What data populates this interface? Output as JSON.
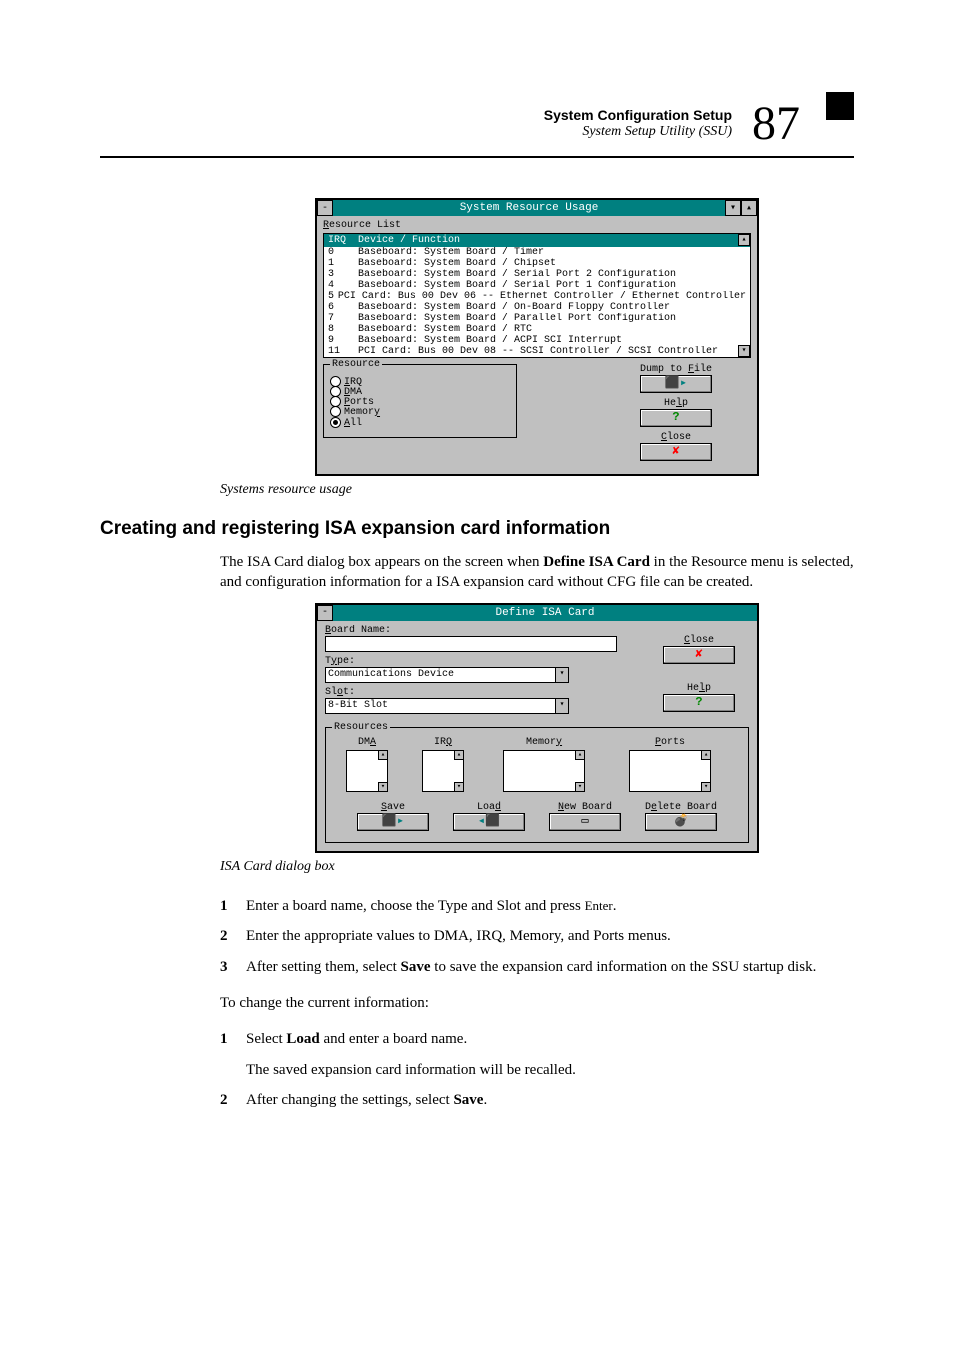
{
  "header": {
    "title": "System Configuration Setup",
    "subtitle": "System Setup Utility (SSU)",
    "page_number": "87"
  },
  "dialog1": {
    "title": "System Resource Usage",
    "list_label": "Resource List",
    "col_irq": "IRQ",
    "col_dev": "Device / Function",
    "rows": [
      {
        "irq": "0",
        "dev": "Baseboard: System Board / Timer"
      },
      {
        "irq": "1",
        "dev": "Baseboard: System Board / Chipset"
      },
      {
        "irq": "3",
        "dev": "Baseboard: System Board / Serial Port 2 Configuration"
      },
      {
        "irq": "4",
        "dev": "Baseboard: System Board / Serial Port 1 Configuration"
      },
      {
        "irq": "5",
        "dev": "PCI Card: Bus 00 Dev 06 -- Ethernet Controller / Ethernet Controller"
      },
      {
        "irq": "6",
        "dev": "Baseboard: System Board / On-Board Floppy Controller"
      },
      {
        "irq": "7",
        "dev": "Baseboard: System Board / Parallel Port Configuration"
      },
      {
        "irq": "8",
        "dev": "Baseboard: System Board / RTC"
      },
      {
        "irq": "9",
        "dev": "Baseboard: System Board / ACPI SCI Interrupt"
      },
      {
        "irq": "11",
        "dev": "PCI Card: Bus 00 Dev 08 -- SCSI Controller / SCSI Controller"
      }
    ],
    "group_label": "Resource",
    "radio_irq": "IRQ",
    "radio_dma": "DMA",
    "radio_ports": "Ports",
    "radio_memory": "Memory",
    "radio_all": "All",
    "btn_dump": "Dump to File",
    "btn_help": "Help",
    "btn_close": "Close"
  },
  "caption1": "Systems resource usage",
  "section_heading": "Creating and registering ISA expansion card information",
  "para1_a": "The ISA Card dialog box appears on the screen when ",
  "para1_bold": "Define ISA Card",
  "para1_b": " in the Resource menu is selected, and configuration information for a ISA expansion card without CFG file can be created.",
  "dialog2": {
    "title": "Define ISA Card",
    "board_name_label": "Board Name:",
    "type_label": "Type:",
    "type_value": "Communications Device",
    "slot_label": "Slot:",
    "slot_value": "8-Bit Slot",
    "resources_label": "Resources",
    "dma": "DMA",
    "irq": "IRQ",
    "memory": "Memory",
    "ports": "Ports",
    "close": "Close",
    "help": "Help",
    "save": "Save",
    "load": "Load",
    "new_board": "New Board",
    "delete_board": "Delete Board"
  },
  "caption2": "ISA Card dialog box",
  "step1_a": "Enter a board name, choose the Type and Slot and press ",
  "step1_key": "Enter",
  "step1_b": ".",
  "step2": "Enter the appropriate values to DMA, IRQ, Memory, and Ports menus.",
  "step3_a": "After setting them, select ",
  "step3_bold": "Save",
  "step3_b": " to save the expansion card information on the SSU startup disk.",
  "para2": "To change the current information:",
  "cstep1_a": "Select ",
  "cstep1_bold": "Load",
  "cstep1_b": " and enter a board name.",
  "cstep1_note": "The saved expansion card information will be recalled.",
  "cstep2_a": "After changing the settings, select ",
  "cstep2_bold": "Save",
  "cstep2_b": "."
}
